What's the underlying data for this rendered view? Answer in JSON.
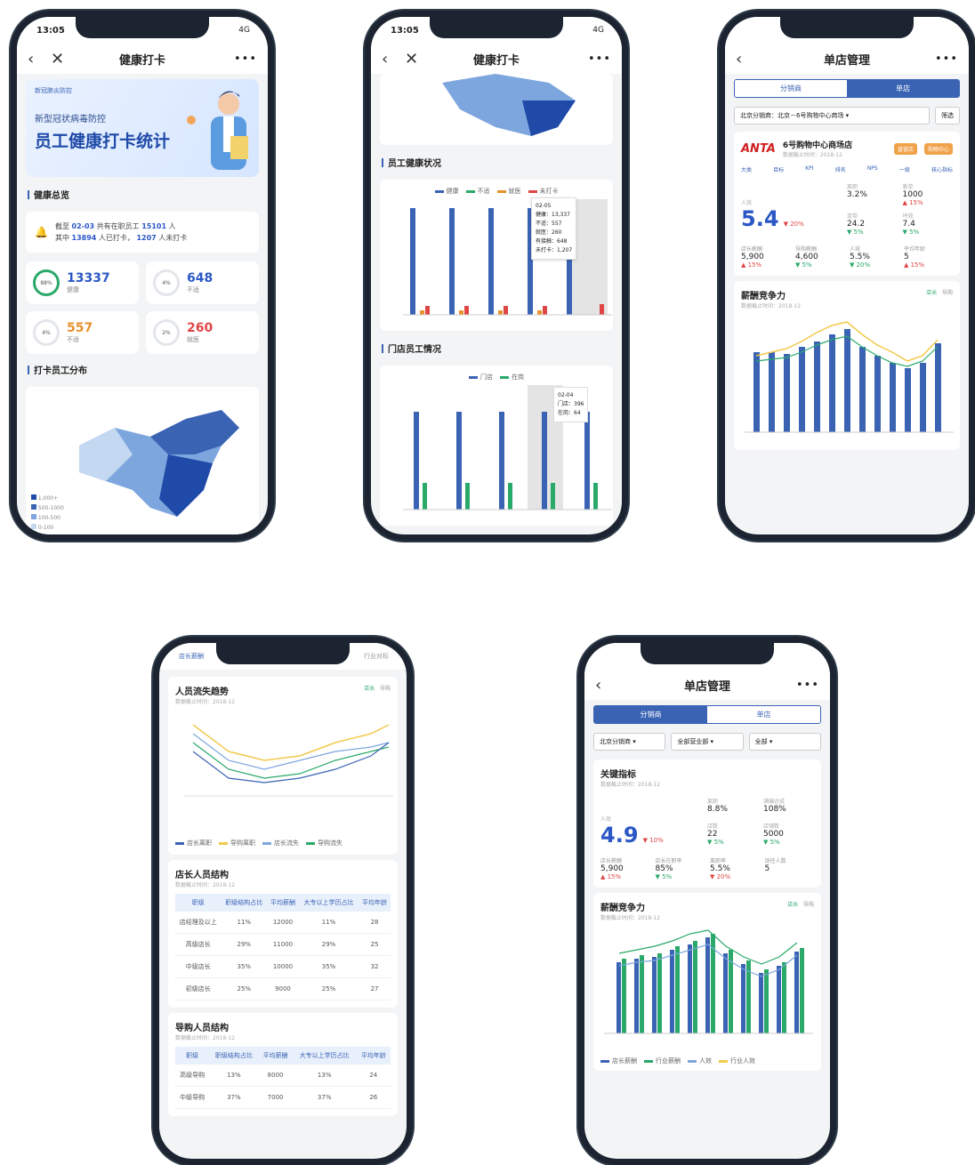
{
  "phone1": {
    "time": "13:05",
    "signal": "4G",
    "nav_title": "健康打卡",
    "banner": {
      "logo": "新冠肺炎防控",
      "subtitle": "新型冠状病毒防控",
      "title": "员工健康打卡统计"
    },
    "overview_title": "健康总览",
    "notice_line1_pre": "截至",
    "notice_date": "02-03",
    "notice_line1_mid": "共有在职员工",
    "notice_total": "15101",
    "notice_line1_post": "人",
    "notice_line2_pre": "其中",
    "notice_checked": "13894",
    "notice_line2_mid": "人已打卡，",
    "notice_unchecked": "1207",
    "notice_line2_post": "人未打卡",
    "stats": [
      {
        "ring": "88%",
        "value": "13337",
        "label": "健康",
        "color": "#2b58c6"
      },
      {
        "ring": "4%",
        "value": "648",
        "label": "不适",
        "color": "#2b58c6"
      },
      {
        "ring": "4%",
        "value": "557",
        "label": "不适",
        "color": "#e8922e"
      },
      {
        "ring": "2%",
        "value": "260",
        "label": "就医",
        "color": "#e04545"
      }
    ],
    "dist_title": "打卡员工分布",
    "map_legend": [
      "1,000+",
      "500-1000",
      "100-500",
      "0-100"
    ]
  },
  "phone2": {
    "time": "13:05",
    "signal": "4G",
    "nav_title": "健康打卡",
    "status_title": "员工健康状况",
    "status_legend": [
      "健康",
      "不适",
      "就医",
      "未打卡"
    ],
    "tooltip1": {
      "date": "02-05",
      "lines": [
        "健康：13,337",
        "不适：557",
        "就医：260",
        "有接触：648",
        "未打卡：1,207"
      ]
    },
    "store_title": "门店员工情况",
    "store_legend": [
      "门店",
      "在岗"
    ],
    "tooltip2": {
      "date": "02-04",
      "lines": [
        "门店：396",
        "在岗：64"
      ]
    }
  },
  "phone3": {
    "nav_title": "单店管理",
    "tabs": [
      "分销商",
      "单店"
    ],
    "filter": "北京分销商：北京－6号购物中心商场",
    "filter_btn": "筛选",
    "store_name": "6号购物中心商场店",
    "brand": "ANTA",
    "meta": "数据截止时间：2018-12",
    "tags": [
      "直营店",
      "购物中心"
    ],
    "menu": [
      "大类",
      "目标",
      "KPI",
      "排名",
      "NPS",
      "一级",
      "核心指标"
    ],
    "kpi_main_label": "人效",
    "kpi_main_value": "5.4",
    "kpi_main_delta": "▼ 20%",
    "side_kpis": [
      {
        "label": "离职",
        "value": "3.2%",
        "delta": ""
      },
      {
        "label": "客单",
        "value": "1000",
        "delta": "▲ 15%"
      },
      {
        "label": "连带",
        "value": "24.2",
        "delta": "▼ 5%"
      },
      {
        "label": "坪效",
        "value": "7.4",
        "delta": "▼ 5%"
      }
    ],
    "bottom_kpis": [
      {
        "label": "店长薪酬",
        "value": "5,900",
        "delta": "▲ 15%"
      },
      {
        "label": "导购薪酬",
        "value": "4,600",
        "delta": "▼ 5%"
      },
      {
        "label": "人效",
        "value": "5.5%",
        "delta": "▼ 20%"
      },
      {
        "label": "平均年龄",
        "value": "5",
        "delta": "▲ 15%"
      }
    ],
    "salary_title": "薪酬竞争力",
    "salary_meta": "数据截止时间：2018-12",
    "salary_links": [
      "店长",
      "导购"
    ]
  },
  "phone4": {
    "header_left": "店长薪酬",
    "header_right": "行业对标",
    "loss_title": "人员流失趋势",
    "loss_meta": "数据截止时间：2018-12",
    "loss_links": [
      "店长",
      "导购"
    ],
    "loss_legend": [
      "店长离职",
      "导购离职",
      "店长流失",
      "导购流失"
    ],
    "mgr_title": "店长人员结构",
    "mgr_meta": "数据截止时间：2018-12",
    "mgr_headers": [
      "职级",
      "职级结构占比",
      "平均薪酬",
      "大专以上学历占比",
      "平均年龄"
    ],
    "mgr_rows": [
      [
        "店经理及以上",
        "11%",
        "12000",
        "11%",
        "28"
      ],
      [
        "高级店长",
        "29%",
        "11000",
        "29%",
        "25"
      ],
      [
        "中级店长",
        "35%",
        "10000",
        "35%",
        "32"
      ],
      [
        "初级店长",
        "25%",
        "9000",
        "25%",
        "27"
      ]
    ],
    "guide_title": "导购人员结构",
    "guide_meta": "数据截止时间：2018-12",
    "guide_headers": [
      "职级",
      "职级结构占比",
      "平均薪酬",
      "大专以上学历占比",
      "平均年龄"
    ],
    "guide_rows": [
      [
        "高级导购",
        "13%",
        "8000",
        "13%",
        "24"
      ],
      [
        "中级导购",
        "37%",
        "7000",
        "37%",
        "26"
      ]
    ]
  },
  "phone5": {
    "nav_title": "单店管理",
    "tabs": [
      "分销商",
      "单店"
    ],
    "filters": [
      "北京分销商",
      "全部营业部",
      "全部"
    ],
    "key_title": "关键指标",
    "key_meta": "数据截止时间：2018-12",
    "kpi_main_label": "人效",
    "kpi_main_value": "4.9",
    "kpi_main_delta": "▼ 10%",
    "side_kpis": [
      {
        "label": "离职",
        "value": "8.8%",
        "delta": ""
      },
      {
        "label": "满编达成",
        "value": "108%",
        "delta": ""
      },
      {
        "label": "店数",
        "value": "22",
        "delta": "▼ 5%"
      },
      {
        "label": "店铺数",
        "value": "5000",
        "delta": "▼ 5%"
      }
    ],
    "bottom_kpis": [
      {
        "label": "店长薪酬",
        "value": "5,900",
        "delta": "▲ 15%"
      },
      {
        "label": "店长在职率",
        "value": "85%",
        "delta": "▼ 5%"
      },
      {
        "label": "离职率",
        "value": "5.5%",
        "delta": "▼ 20%"
      },
      {
        "label": "现任人数",
        "value": "5",
        "delta": ""
      }
    ],
    "salary_title": "薪酬竞争力",
    "salary_meta": "数据截止时间：2018-12",
    "salary_links": [
      "店长",
      "导购"
    ],
    "legend": [
      "店长薪酬",
      "行业薪酬",
      "人效",
      "行业人效"
    ]
  }
}
